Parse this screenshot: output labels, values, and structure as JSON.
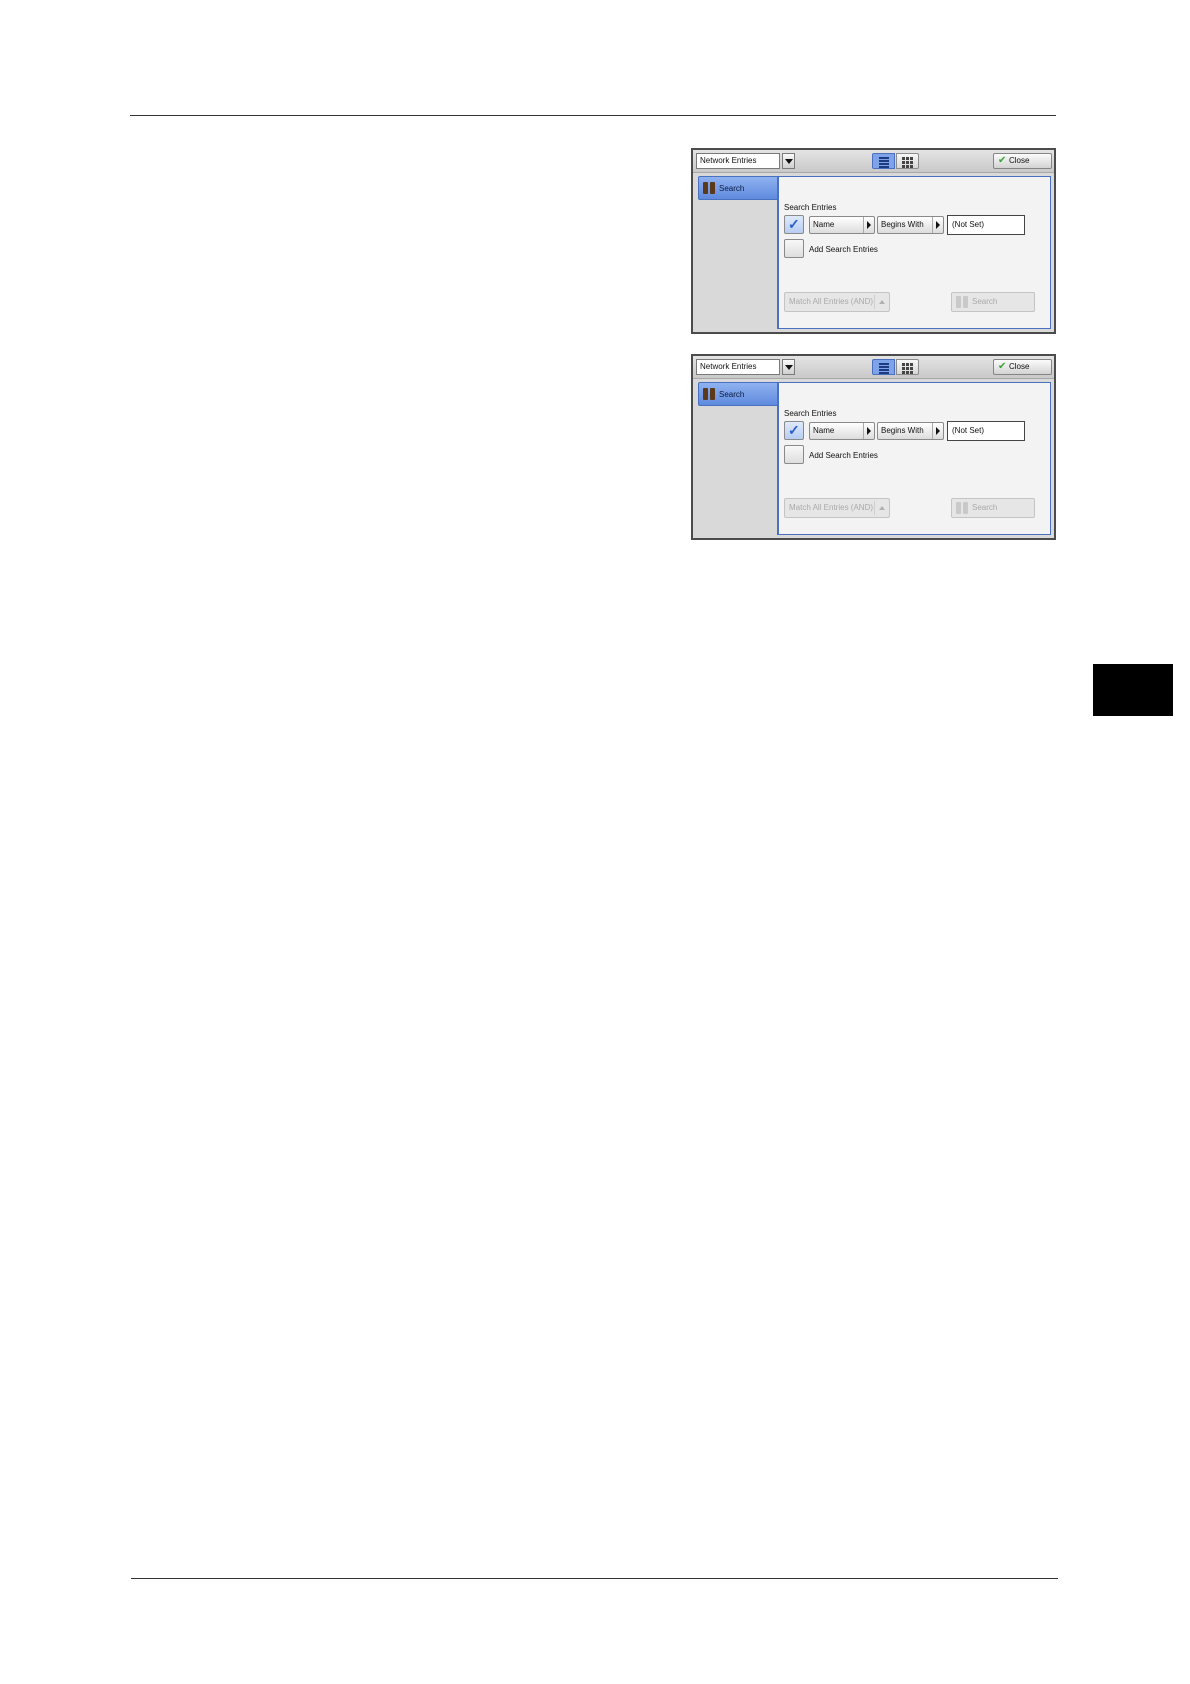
{
  "screens": [
    {
      "address_book_dropdown": "Network Entries",
      "close_label": "Close",
      "side_tab_label": "Search",
      "section_title": "Search Entries",
      "field_selector": "Name",
      "condition_selector": "Begins With",
      "search_value": "(Not Set)",
      "add_entries_label": "Add Search Entries",
      "match_label": "Match All Entries (AND)",
      "search_button_label": "Search"
    },
    {
      "address_book_dropdown": "Network Entries",
      "close_label": "Close",
      "side_tab_label": "Search",
      "section_title": "Search Entries",
      "field_selector": "Name",
      "condition_selector": "Begins With",
      "search_value": "(Not Set)",
      "add_entries_label": "Add Search Entries",
      "match_label": "Match All Entries (AND)",
      "search_button_label": "Search"
    }
  ]
}
